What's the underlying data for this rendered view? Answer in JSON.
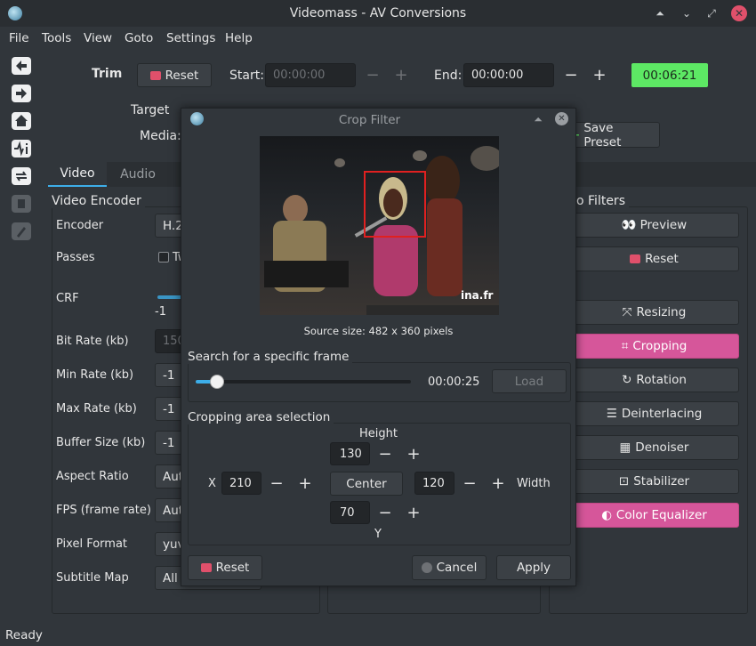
{
  "window": {
    "title": "Videomass - AV Conversions"
  },
  "menubar": {
    "items": [
      "File",
      "Tools",
      "View",
      "Goto",
      "Settings",
      "Help"
    ]
  },
  "trim": {
    "label": "Trim",
    "reset": "Reset",
    "start_label": "Start:",
    "start_value": "00:00:00",
    "end_label": "End:",
    "end_value": "00:00:00",
    "duration": "00:06:21"
  },
  "target": {
    "label": "Target",
    "media_label": "Media:",
    "save_preset": "Save Preset"
  },
  "tabs": [
    "Video",
    "Audio"
  ],
  "encoder_panel": {
    "title": "Video Encoder",
    "encoder_label": "Encoder",
    "encoder_value": "H.2",
    "passes_label": "Passes",
    "passes_value": "Tw",
    "crf_label": "CRF",
    "crf_value": "-1",
    "bitrate_label": "Bit Rate (kb)",
    "bitrate_value": "150",
    "minrate_label": "Min Rate (kb)",
    "minrate_value": "-1",
    "maxrate_label": "Max Rate (kb)",
    "maxrate_value": "-1",
    "bufsize_label": "Buffer Size (kb)",
    "bufsize_value": "-1",
    "aspect_label": "Aspect Ratio",
    "aspect_value": "Aut",
    "fps_label": "FPS (frame rate)",
    "fps_value": "Aut",
    "pixfmt_label": "Pixel Format",
    "pixfmt_value": "yuv",
    "submap_label": "Subtitle Map",
    "submap_value": "All"
  },
  "filters": {
    "title": "o Filters",
    "buttons": [
      {
        "label": "Preview",
        "active": false
      },
      {
        "label": "Reset",
        "active": false
      },
      {
        "label": "Resizing",
        "active": false
      },
      {
        "label": "Cropping",
        "active": true
      },
      {
        "label": "Rotation",
        "active": false
      },
      {
        "label": "Deinterlacing",
        "active": false
      },
      {
        "label": "Denoiser",
        "active": false
      },
      {
        "label": "Stabilizer",
        "active": false
      },
      {
        "label": "Color Equalizer",
        "active": true
      }
    ]
  },
  "statusbar": {
    "text": "Ready"
  },
  "crop_dialog": {
    "title": "Crop Filter",
    "source_size": "Source size: 482 x 360 pixels",
    "watermark": "ina.fr",
    "search_title": "Search for a specific frame",
    "time": "00:00:25",
    "slider_fraction": 0.08,
    "load": "Load",
    "area_title": "Cropping area selection",
    "height_label": "Height",
    "height_value": "130",
    "x_label": "X",
    "x_value": "210",
    "center": "Center",
    "width_value": "120",
    "width_label": "Width",
    "y_value": "70",
    "y_label": "Y",
    "reset": "Reset",
    "cancel": "Cancel",
    "apply": "Apply"
  },
  "colors": {
    "accent": "#3daee9",
    "pink": "#d6569a",
    "green": "#5de864",
    "crop_rect": "#e02020"
  }
}
